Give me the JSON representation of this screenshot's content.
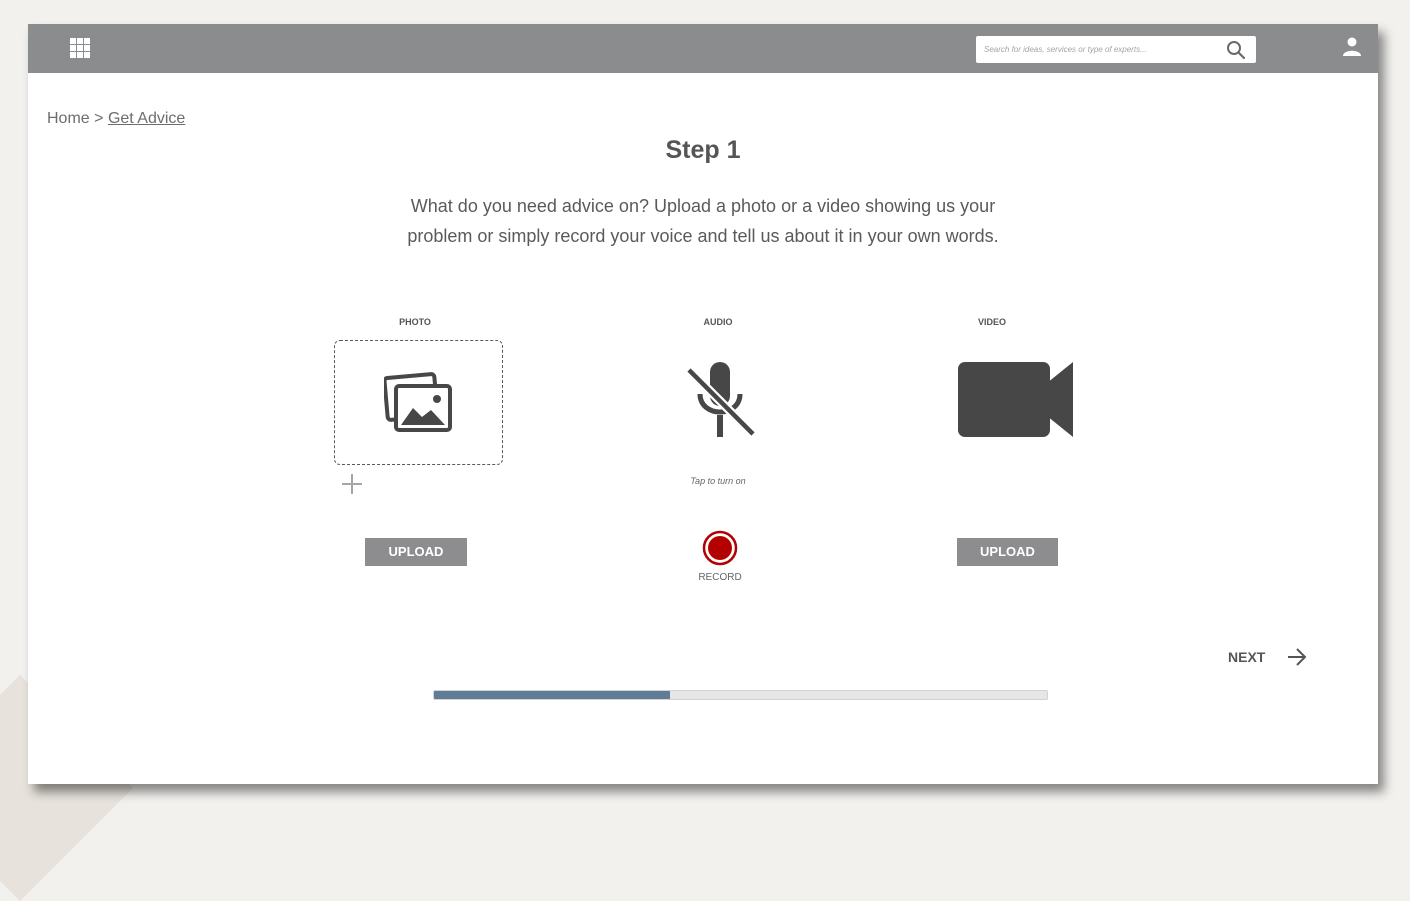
{
  "header": {
    "search_placeholder": "Search for ideas, services or type of experts..."
  },
  "breadcrumb": {
    "home": "Home",
    "separator": ">",
    "current": "Get Advice"
  },
  "step": {
    "title": "Step 1",
    "line1": "What do you need advice on? Upload a photo or a video showing us your",
    "line2": "problem or simply record your voice and tell us about it in your own words."
  },
  "photo": {
    "label": "PHOTO",
    "upload_label": "UPLOAD"
  },
  "audio": {
    "label": "AUDIO",
    "hint": "Tap to turn on",
    "record_label": "RECORD"
  },
  "video": {
    "label": "VIDEO",
    "upload_label": "UPLOAD"
  },
  "navigation": {
    "next_label": "NEXT"
  },
  "progress": {
    "value": 0.385
  },
  "colors": {
    "topbar": "#8b8c8e",
    "button": "#8d8d8f",
    "record": "#b30000",
    "progress_fill": "#5f7d96",
    "icon": "#474747"
  },
  "icons": [
    "apps-grid-icon",
    "search-icon",
    "user-icon",
    "photo-icon",
    "plus-icon",
    "mic-off-icon",
    "video-camera-icon",
    "record-icon",
    "arrow-right-icon"
  ]
}
